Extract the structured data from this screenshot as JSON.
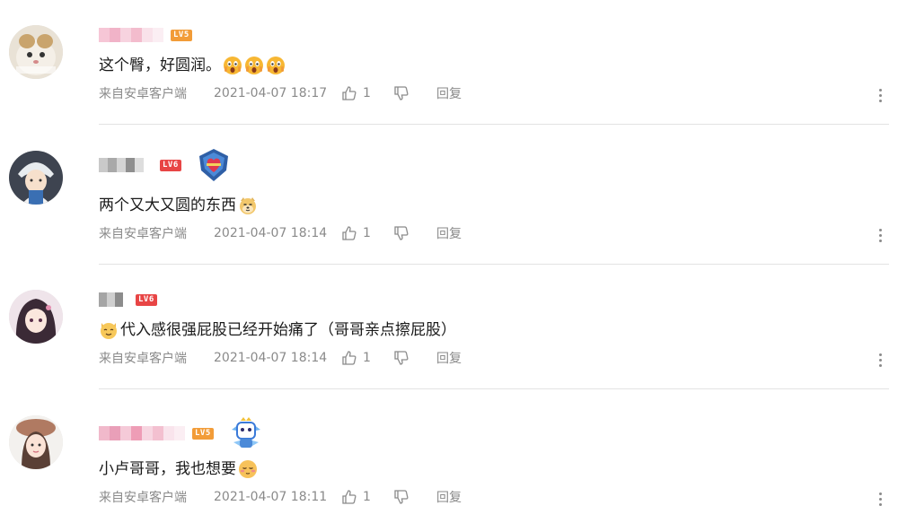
{
  "comments": [
    {
      "level": "LV5",
      "level_color": "#f29c38",
      "text": "这个臀，好圆润。",
      "emoji": "fear-emoji x3",
      "source": "来自安卓客户端",
      "time": "2021-04-07 18:17",
      "likes": "1",
      "reply": "回复"
    },
    {
      "level": "LV6",
      "level_color": "#e84545",
      "text": "两个又大又圆的东西",
      "emoji": "doge-emoji",
      "source": "来自安卓客户端",
      "time": "2021-04-07 18:14",
      "likes": "1",
      "reply": "回复"
    },
    {
      "level": "LV6",
      "level_color": "#e84545",
      "text": "代入感很强屁股已经开始痛了（哥哥亲点擦屁股）",
      "emoji": "cat-emoji",
      "source": "来自安卓客户端",
      "time": "2021-04-07 18:14",
      "likes": "1",
      "reply": "回复"
    },
    {
      "level": "LV5",
      "level_color": "#f29c38",
      "text": "小卢哥哥，我也想要",
      "emoji": "shy-emoji",
      "source": "来自安卓客户端",
      "time": "2021-04-07 18:11",
      "likes": "1",
      "reply": "回复"
    }
  ],
  "icons": {
    "like": "thumbs-up-icon",
    "dislike": "thumbs-down-icon",
    "more": "more-vertical-icon"
  }
}
